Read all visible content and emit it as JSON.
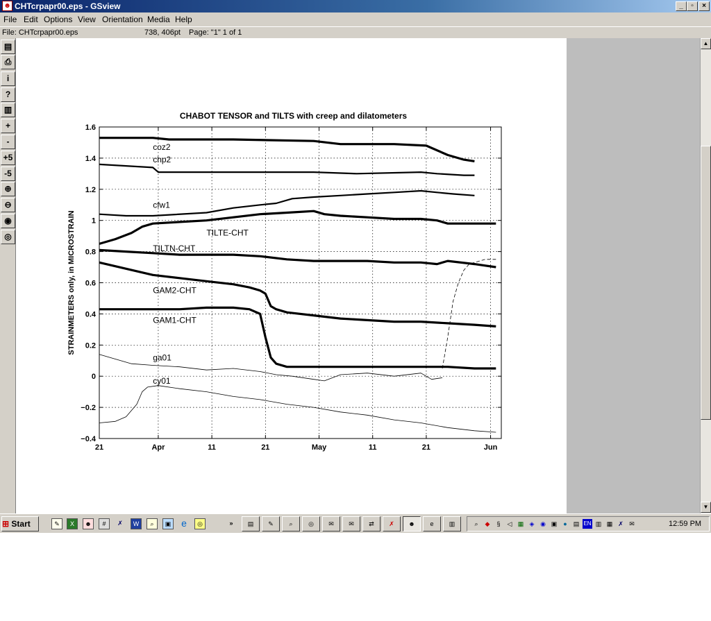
{
  "window": {
    "title": "CHTcrpapr00.eps - GSview"
  },
  "menu": [
    "File",
    "Edit",
    "Options",
    "View",
    "Orientation",
    "Media",
    "Help"
  ],
  "status": {
    "file": "File: CHTcrpapr00.eps",
    "coords": "738, 406pt",
    "page": "Page: \"1\"  1 of 1"
  },
  "toolbar": [
    {
      "icon": "open-icon",
      "label": ""
    },
    {
      "icon": "print-icon",
      "label": ""
    },
    {
      "icon": "info-icon",
      "label": "i"
    },
    {
      "icon": "help-icon",
      "label": "?"
    },
    {
      "icon": "goto-page-icon",
      "label": ""
    },
    {
      "icon": "next-page-icon",
      "label": "+"
    },
    {
      "icon": "prev-page-icon",
      "label": "-"
    },
    {
      "icon": "forward-5-icon",
      "label": "+5"
    },
    {
      "icon": "back-5-icon",
      "label": "-5"
    },
    {
      "icon": "zoom-in-icon",
      "label": "⊕"
    },
    {
      "icon": "zoom-out-icon",
      "label": "⊖"
    },
    {
      "icon": "eye-abc-icon",
      "label": ""
    },
    {
      "icon": "eye-icon",
      "label": ""
    }
  ],
  "chart_data": {
    "type": "line",
    "title": "CHABOT TENSOR  and TILTS with  creep and dilatometers",
    "ylabel": "STRAINMETERS only,  in MICROSTRAIN",
    "xlabel": "",
    "ylim": [
      -0.4,
      1.6
    ],
    "yticks": [
      -0.4,
      -0.2,
      0,
      0.2,
      0.4,
      0.6,
      0.8,
      1,
      1.2,
      1.4,
      1.6
    ],
    "ytick_labels": [
      "−0.4",
      "−0.2",
      "0",
      "0.2",
      "0.4",
      "0.6",
      "0.8",
      "1",
      "1.2",
      "1.4",
      "1.6"
    ],
    "xlim": [
      0,
      75
    ],
    "xticks": [
      0,
      11,
      21,
      31,
      41,
      51,
      61,
      73
    ],
    "xtick_labels": [
      "21",
      "Apr",
      "11",
      "21",
      "May",
      "11",
      "21",
      "Jun"
    ],
    "grid": true,
    "series": [
      {
        "name": "coz2",
        "style": "bold",
        "points": [
          [
            0,
            1.53
          ],
          [
            5,
            1.53
          ],
          [
            10,
            1.53
          ],
          [
            13,
            1.52
          ],
          [
            15,
            1.52
          ],
          [
            25,
            1.52
          ],
          [
            40,
            1.51
          ],
          [
            45,
            1.49
          ],
          [
            55,
            1.49
          ],
          [
            61,
            1.48
          ],
          [
            65,
            1.42
          ],
          [
            68,
            1.39
          ],
          [
            70,
            1.38
          ]
        ]
      },
      {
        "name": "chp2",
        "style": "medium",
        "points": [
          [
            0,
            1.36
          ],
          [
            5,
            1.35
          ],
          [
            10,
            1.34
          ],
          [
            11,
            1.31
          ],
          [
            15,
            1.31
          ],
          [
            30,
            1.31
          ],
          [
            40,
            1.31
          ],
          [
            48,
            1.3
          ],
          [
            60,
            1.31
          ],
          [
            63,
            1.3
          ],
          [
            68,
            1.29
          ],
          [
            70,
            1.29
          ]
        ]
      },
      {
        "name": "cfw1",
        "style": "medium",
        "points": [
          [
            0,
            1.04
          ],
          [
            5,
            1.03
          ],
          [
            10,
            1.03
          ],
          [
            20,
            1.05
          ],
          [
            25,
            1.08
          ],
          [
            30,
            1.1
          ],
          [
            33,
            1.11
          ],
          [
            36,
            1.14
          ],
          [
            40,
            1.15
          ],
          [
            45,
            1.16
          ],
          [
            50,
            1.17
          ],
          [
            55,
            1.18
          ],
          [
            60,
            1.19
          ],
          [
            63,
            1.18
          ],
          [
            66,
            1.17
          ],
          [
            70,
            1.16
          ]
        ]
      },
      {
        "name": "TILTE-CHT",
        "style": "bold",
        "points": [
          [
            0,
            0.85
          ],
          [
            3,
            0.88
          ],
          [
            6,
            0.92
          ],
          [
            8,
            0.96
          ],
          [
            10,
            0.98
          ],
          [
            15,
            0.99
          ],
          [
            20,
            1.0
          ],
          [
            25,
            1.02
          ],
          [
            30,
            1.04
          ],
          [
            35,
            1.05
          ],
          [
            40,
            1.06
          ],
          [
            42,
            1.04
          ],
          [
            45,
            1.03
          ],
          [
            50,
            1.02
          ],
          [
            55,
            1.01
          ],
          [
            60,
            1.01
          ],
          [
            63,
            1.0
          ],
          [
            65,
            0.98
          ],
          [
            70,
            0.98
          ],
          [
            74,
            0.98
          ]
        ]
      },
      {
        "name": "TILTN-CHT",
        "style": "bold",
        "points": [
          [
            0,
            0.81
          ],
          [
            5,
            0.8
          ],
          [
            10,
            0.79
          ],
          [
            15,
            0.78
          ],
          [
            20,
            0.78
          ],
          [
            25,
            0.78
          ],
          [
            30,
            0.77
          ],
          [
            35,
            0.75
          ],
          [
            40,
            0.74
          ],
          [
            45,
            0.74
          ],
          [
            50,
            0.74
          ],
          [
            55,
            0.73
          ],
          [
            60,
            0.73
          ],
          [
            63,
            0.72
          ],
          [
            65,
            0.74
          ],
          [
            70,
            0.72
          ],
          [
            74,
            0.7
          ]
        ]
      },
      {
        "name": "GAM2-CHT",
        "style": "bold",
        "points": [
          [
            0,
            0.73
          ],
          [
            5,
            0.69
          ],
          [
            10,
            0.65
          ],
          [
            15,
            0.63
          ],
          [
            20,
            0.61
          ],
          [
            25,
            0.59
          ],
          [
            28,
            0.57
          ],
          [
            30,
            0.55
          ],
          [
            31,
            0.53
          ],
          [
            32,
            0.45
          ],
          [
            33,
            0.43
          ],
          [
            35,
            0.41
          ],
          [
            40,
            0.39
          ],
          [
            45,
            0.37
          ],
          [
            50,
            0.36
          ],
          [
            55,
            0.35
          ],
          [
            60,
            0.35
          ],
          [
            65,
            0.34
          ],
          [
            70,
            0.33
          ],
          [
            74,
            0.32
          ]
        ]
      },
      {
        "name": "GAM1-CHT",
        "style": "bold",
        "points": [
          [
            0,
            0.43
          ],
          [
            5,
            0.43
          ],
          [
            10,
            0.43
          ],
          [
            15,
            0.43
          ],
          [
            20,
            0.44
          ],
          [
            25,
            0.44
          ],
          [
            28,
            0.43
          ],
          [
            30,
            0.4
          ],
          [
            31,
            0.25
          ],
          [
            32,
            0.12
          ],
          [
            33,
            0.08
          ],
          [
            35,
            0.06
          ],
          [
            40,
            0.06
          ],
          [
            50,
            0.06
          ],
          [
            60,
            0.06
          ],
          [
            65,
            0.06
          ],
          [
            70,
            0.05
          ],
          [
            74,
            0.05
          ]
        ]
      },
      {
        "name": "ga01",
        "style": "thin",
        "points": [
          [
            0,
            0.14
          ],
          [
            3,
            0.11
          ],
          [
            6,
            0.08
          ],
          [
            10,
            0.07
          ],
          [
            15,
            0.06
          ],
          [
            20,
            0.04
          ],
          [
            25,
            0.05
          ],
          [
            30,
            0.03
          ],
          [
            33,
            0.01
          ],
          [
            36,
            0
          ],
          [
            40,
            -0.02
          ],
          [
            42,
            -0.03
          ],
          [
            45,
            0.01
          ],
          [
            50,
            0.02
          ],
          [
            55,
            0
          ],
          [
            60,
            0.02
          ],
          [
            62,
            -0.02
          ],
          [
            64,
            -0.01
          ]
        ]
      },
      {
        "name": "cy01",
        "style": "thin",
        "points": [
          [
            0,
            -0.3
          ],
          [
            3,
            -0.29
          ],
          [
            5,
            -0.26
          ],
          [
            7,
            -0.18
          ],
          [
            8,
            -0.1
          ],
          [
            9,
            -0.07
          ],
          [
            11,
            -0.06
          ],
          [
            15,
            -0.08
          ],
          [
            20,
            -0.1
          ],
          [
            25,
            -0.13
          ],
          [
            30,
            -0.15
          ],
          [
            35,
            -0.18
          ],
          [
            40,
            -0.2
          ],
          [
            45,
            -0.23
          ],
          [
            50,
            -0.25
          ],
          [
            55,
            -0.28
          ],
          [
            60,
            -0.3
          ],
          [
            65,
            -0.33
          ],
          [
            70,
            -0.35
          ],
          [
            74,
            -0.36
          ]
        ]
      },
      {
        "name": "",
        "style": "dashed",
        "points": [
          [
            64,
            0.05
          ],
          [
            65,
            0.25
          ],
          [
            66,
            0.48
          ],
          [
            67,
            0.6
          ],
          [
            68,
            0.68
          ],
          [
            69,
            0.72
          ],
          [
            72,
            0.75
          ],
          [
            74,
            0.75
          ]
        ]
      }
    ]
  }
}
